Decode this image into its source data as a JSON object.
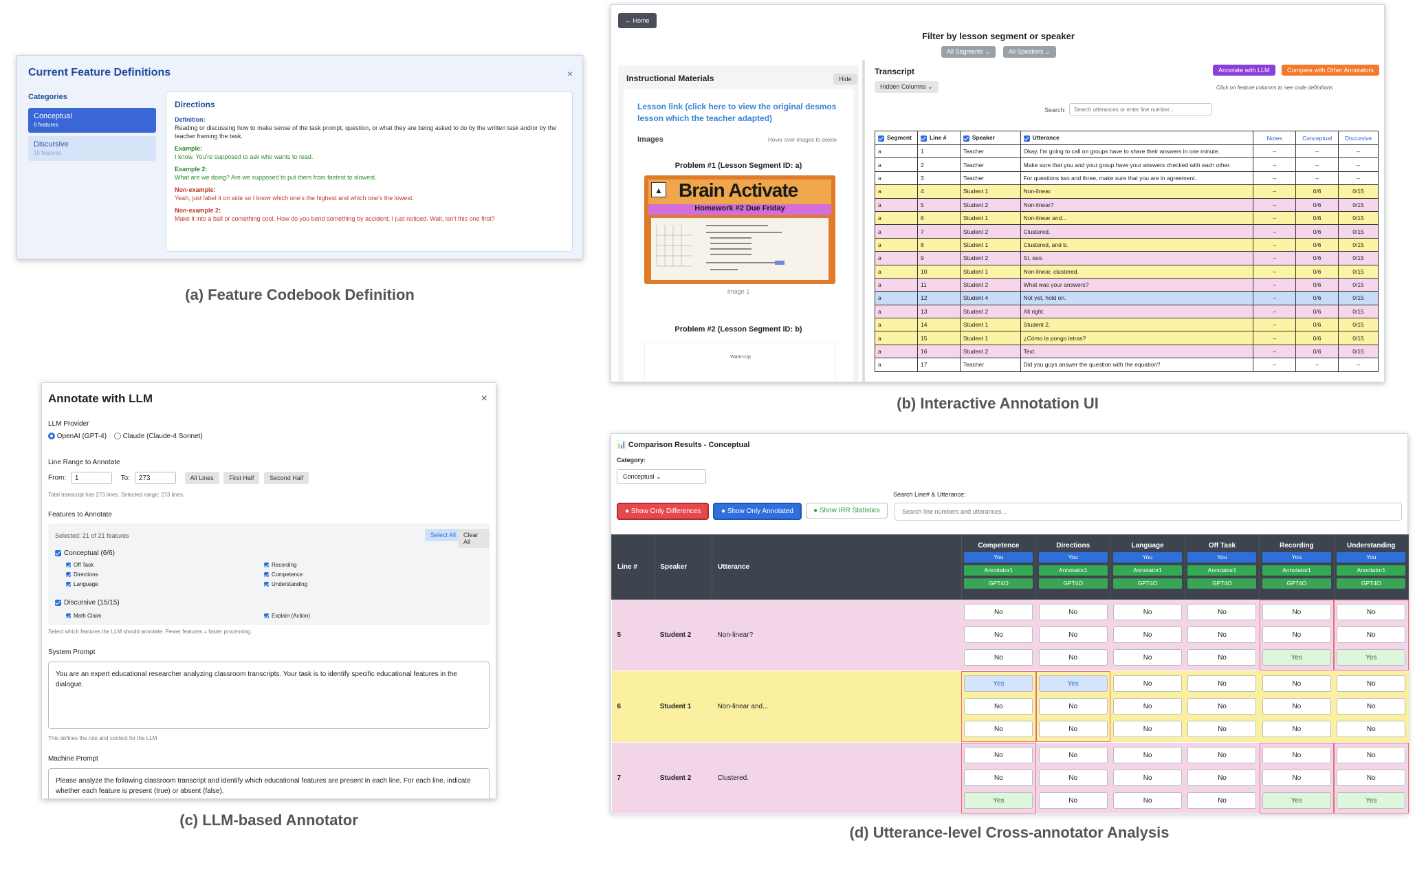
{
  "captions": {
    "a": "(a) Feature Codebook Definition",
    "b": "(b) Interactive Annotation UI",
    "c": "(c) LLM-based Annotator",
    "d": "(d) Utterance-level Cross-annotator Analysis"
  },
  "panel_a": {
    "title": "Current Feature Definitions",
    "close": "×",
    "categories_label": "Categories",
    "categories": [
      {
        "name": "Conceptual",
        "count": "6 features"
      },
      {
        "name": "Discursive",
        "count": "15 features"
      }
    ],
    "feature": "Directions",
    "definition_label": "Definition:",
    "definition": "Reading or discussing how to make sense of the task prompt, question, or what they are being asked to do by the written task and/or by the teacher framing the task.",
    "example_label": "Example:",
    "example": "I know. You're supposed to ask who wants to read.",
    "example2_label": "Example 2:",
    "example2": "What are we doing? Are we supposed to put them from fastest to slowest.",
    "nonexample_label": "Non-example:",
    "nonexample": "Yeah, just label it on side so I know which one's the highest and which one's the lowest.",
    "nonexample2_label": "Non-example 2:",
    "nonexample2": "Make it into a ball or something cool. How do you bend something by accident, I just noticed. Wait, isn't this one first?"
  },
  "panel_b": {
    "home": "← Home",
    "filter_title": "Filter by lesson segment or speaker",
    "all_segments": "All Segments ⌄",
    "all_speakers": "All Speakers ⌄",
    "materials_title": "Instructional Materials",
    "hide": "Hide",
    "lesson_link": "Lesson link (click here to view the original desmos lesson which the teacher adapted)",
    "images": "Images",
    "hover_hint": "Hover over images to delete",
    "problem1": "Problem #1 (Lesson Segment ID: a)",
    "banner": "Brain Activate",
    "homework": "Homework #2 Due Friday",
    "image1": "Image 1",
    "problem2": "Problem #2 (Lesson Segment ID: b)",
    "warmup": "Warm-Up",
    "transcript_title": "Transcript",
    "annotate_llm": "Annotate with LLM",
    "compare": "Compare with Other Annotators",
    "hidden_columns": "Hidden Columns ⌄",
    "click_hint": "Click on feature columns to see code definitions",
    "search_label": "Search:",
    "search_placeholder": "Search utterances or enter line number...",
    "columns": [
      "Segment",
      "Line #",
      "Speaker",
      "Utterance",
      "Notes",
      "Conceptual",
      "Discursive"
    ],
    "rows": [
      [
        "a",
        "1",
        "Teacher",
        "Okay, I'm going to call on groups have to share their answers in one minute.",
        "–",
        "–",
        "–",
        "w"
      ],
      [
        "a",
        "2",
        "Teacher",
        "Make sure that you and your group have your answers checked with each other.",
        "–",
        "–",
        "–",
        "w"
      ],
      [
        "a",
        "3",
        "Teacher",
        "For questions two and three, make sure that you are in agreement.",
        "–",
        "–",
        "–",
        "w"
      ],
      [
        "a",
        "4",
        "Student 1",
        "Non-linear.",
        "–",
        "0/6",
        "0/15",
        "y"
      ],
      [
        "a",
        "5",
        "Student 2",
        "Non-linear?",
        "–",
        "0/6",
        "0/15",
        "p"
      ],
      [
        "a",
        "6",
        "Student 1",
        "Non-linear and...",
        "–",
        "0/6",
        "0/15",
        "y"
      ],
      [
        "a",
        "7",
        "Student 2",
        "Clustered.",
        "–",
        "0/6",
        "0/15",
        "p"
      ],
      [
        "a",
        "8",
        "Student 1",
        "Clustered, and b.",
        "–",
        "0/6",
        "0/15",
        "y"
      ],
      [
        "a",
        "9",
        "Student 2",
        "Sí, eso.",
        "–",
        "0/6",
        "0/15",
        "p"
      ],
      [
        "a",
        "10",
        "Student 1",
        "Non-linear, clustered.",
        "–",
        "0/6",
        "0/15",
        "y"
      ],
      [
        "a",
        "11",
        "Student 2",
        "What was your answers?",
        "–",
        "0/6",
        "0/15",
        "p"
      ],
      [
        "a",
        "12",
        "Student 4",
        "Not yet, hold on.",
        "–",
        "0/6",
        "0/15",
        "b"
      ],
      [
        "a",
        "13",
        "Student 2",
        "All right.",
        "–",
        "0/6",
        "0/15",
        "p"
      ],
      [
        "a",
        "14",
        "Student 1",
        "Student 2.",
        "–",
        "0/6",
        "0/15",
        "y"
      ],
      [
        "a",
        "15",
        "Student 1",
        "¿Cómo le pongo letras?",
        "–",
        "0/6",
        "0/15",
        "y"
      ],
      [
        "a",
        "16",
        "Student 2",
        "Text.",
        "–",
        "0/6",
        "0/15",
        "p"
      ],
      [
        "a",
        "17",
        "Teacher",
        "Did you guys answer the question with the equation?",
        "–",
        "–",
        "–",
        "w"
      ]
    ]
  },
  "panel_c": {
    "title": "Annotate with LLM",
    "close": "×",
    "provider_label": "LLM Provider",
    "provider_openai": "OpenAI (GPT-4)",
    "provider_claude": "Claude (Claude-4 Sonnet)",
    "range_label": "Line Range to Annotate",
    "from_label": "From:",
    "from_value": "1",
    "to_label": "To:",
    "to_value": "273",
    "all_lines": "All Lines",
    "first_half": "First Half",
    "second_half": "Second Half",
    "range_note": "Total transcript has 273 lines. Selected range: 273 lines.",
    "features_label": "Features to Annotate",
    "selected": "Selected: 21 of 21 features",
    "select_all": "Select All",
    "clear_all": "Clear All",
    "group1": "Conceptual (6/6)",
    "group1_items": [
      "Off Task",
      "Recording",
      "Directions",
      "Competence",
      "Language",
      "Understanding"
    ],
    "group2": "Discursive (15/15)",
    "group2_items": [
      "Math Claim",
      "Explain (Action)"
    ],
    "features_note": "Select which features the LLM should annotate. Fewer features = faster processing.",
    "system_label": "System Prompt",
    "system_text": "You are an expert educational researcher analyzing classroom transcripts. Your task is to identify specific educational features in the dialogue.",
    "system_note": "This defines the role and context for the LLM",
    "machine_label": "Machine Prompt",
    "machine_text": "Please analyze the following classroom transcript and identify which educational features are present in each line. For each line, indicate whether each feature is present (true) or absent (false)."
  },
  "panel_d": {
    "title": "📊 Comparison Results - Conceptual",
    "category_label": "Category:",
    "category_value": "Conceptual ⌄",
    "search_label": "Search Line# & Utterance:",
    "search_placeholder": "Search line numbers and utterances...",
    "show_diff": "● Show Only Differences",
    "show_annotated": "● Show Only Annotated",
    "show_irr": "● Show IRR Statistics",
    "head_meta": [
      "Line #",
      "Speaker",
      "Utterance"
    ],
    "features": [
      "Competence",
      "Directions",
      "Language",
      "Off Task",
      "Recording",
      "Understanding"
    ],
    "annotators": [
      "You",
      "Annotator1",
      "GPT4O"
    ],
    "rows": [
      {
        "line": "5",
        "speaker": "Student 2",
        "utterance": "Non-linear?",
        "color": "#f3d5e8",
        "values": [
          [
            "No",
            "No",
            "No"
          ],
          [
            "No",
            "No",
            "No"
          ],
          [
            "No",
            "No",
            "No"
          ],
          [
            "No",
            "No",
            "No"
          ],
          [
            "No",
            "No",
            "Yes"
          ],
          [
            "No",
            "No",
            "Yes"
          ]
        ]
      },
      {
        "line": "6",
        "speaker": "Student 1",
        "utterance": "Non-linear and...",
        "color": "#fbf0a0",
        "values": [
          [
            "Yes",
            "No",
            "No"
          ],
          [
            "Yes",
            "No",
            "No"
          ],
          [
            "No",
            "No",
            "No"
          ],
          [
            "No",
            "No",
            "No"
          ],
          [
            "No",
            "No",
            "No"
          ],
          [
            "No",
            "No",
            "No"
          ]
        ]
      },
      {
        "line": "7",
        "speaker": "Student 2",
        "utterance": "Clustered.",
        "color": "#f3d5e8",
        "values": [
          [
            "No",
            "No",
            "Yes"
          ],
          [
            "No",
            "No",
            "No"
          ],
          [
            "No",
            "No",
            "No"
          ],
          [
            "No",
            "No",
            "No"
          ],
          [
            "No",
            "No",
            "Yes"
          ],
          [
            "No",
            "No",
            "Yes"
          ]
        ]
      }
    ]
  }
}
